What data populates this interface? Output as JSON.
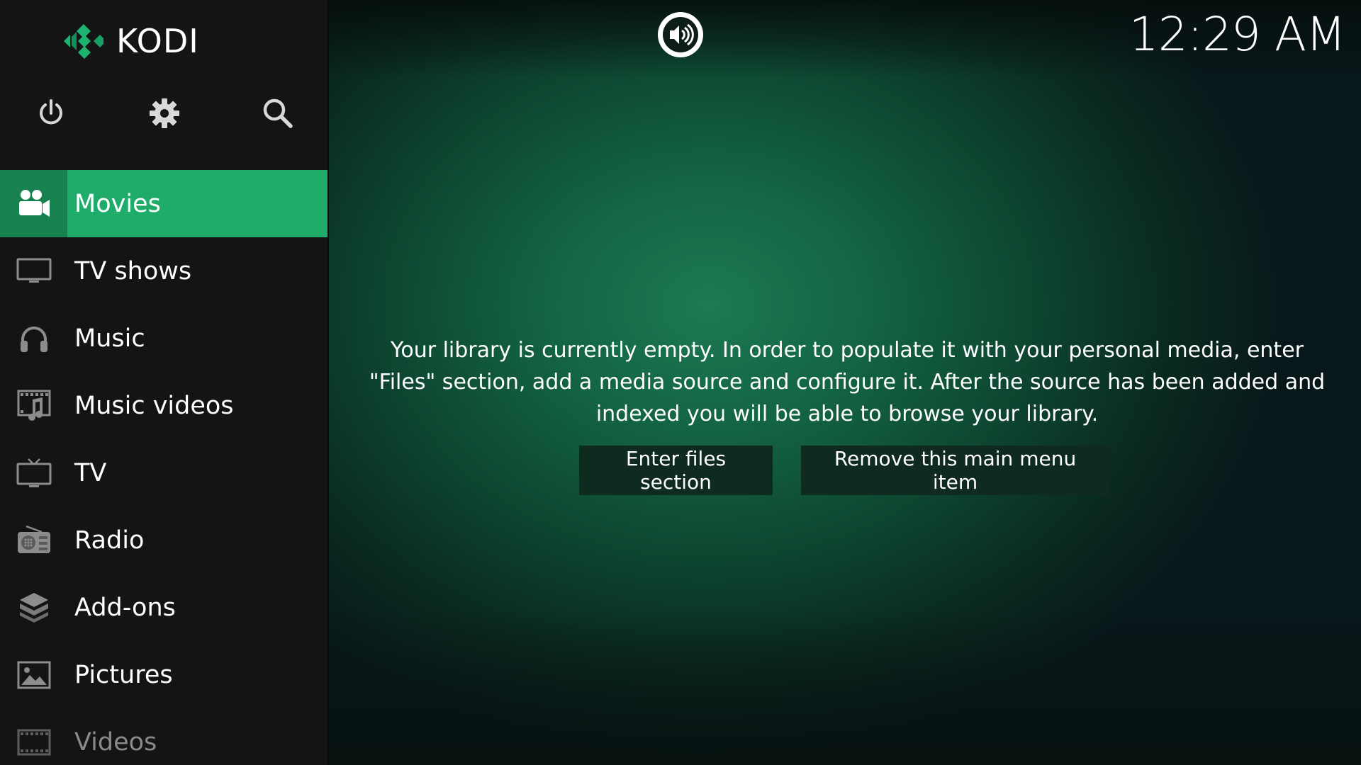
{
  "app": {
    "name": "KODI"
  },
  "header": {
    "clock": "12:29 AM"
  },
  "top_icons": [
    {
      "name": "power-icon"
    },
    {
      "name": "gear-icon"
    },
    {
      "name": "search-icon"
    }
  ],
  "menu": {
    "items": [
      {
        "label": "Movies",
        "icon": "movies-icon",
        "active": true
      },
      {
        "label": "TV shows",
        "icon": "tv-shows-icon"
      },
      {
        "label": "Music",
        "icon": "headphones-icon"
      },
      {
        "label": "Music videos",
        "icon": "music-videos-icon"
      },
      {
        "label": "TV",
        "icon": "tv-icon"
      },
      {
        "label": "Radio",
        "icon": "radio-icon"
      },
      {
        "label": "Add-ons",
        "icon": "addons-icon"
      },
      {
        "label": "Pictures",
        "icon": "pictures-icon"
      },
      {
        "label": "Videos",
        "icon": "videos-icon"
      }
    ]
  },
  "content": {
    "message": "Your library is currently empty. In order to populate it with your personal media, enter \"Files\" section, add a media source and configure it. After the source has been added and indexed you will be able to browse your library.",
    "enter_files_label": "Enter files section",
    "remove_item_label": "Remove this main menu item"
  },
  "colors": {
    "accent": "#1fac6a",
    "accent_dark": "#17814f",
    "sidebar_bg": "#141414",
    "button_bg": "#0f2a1e"
  }
}
